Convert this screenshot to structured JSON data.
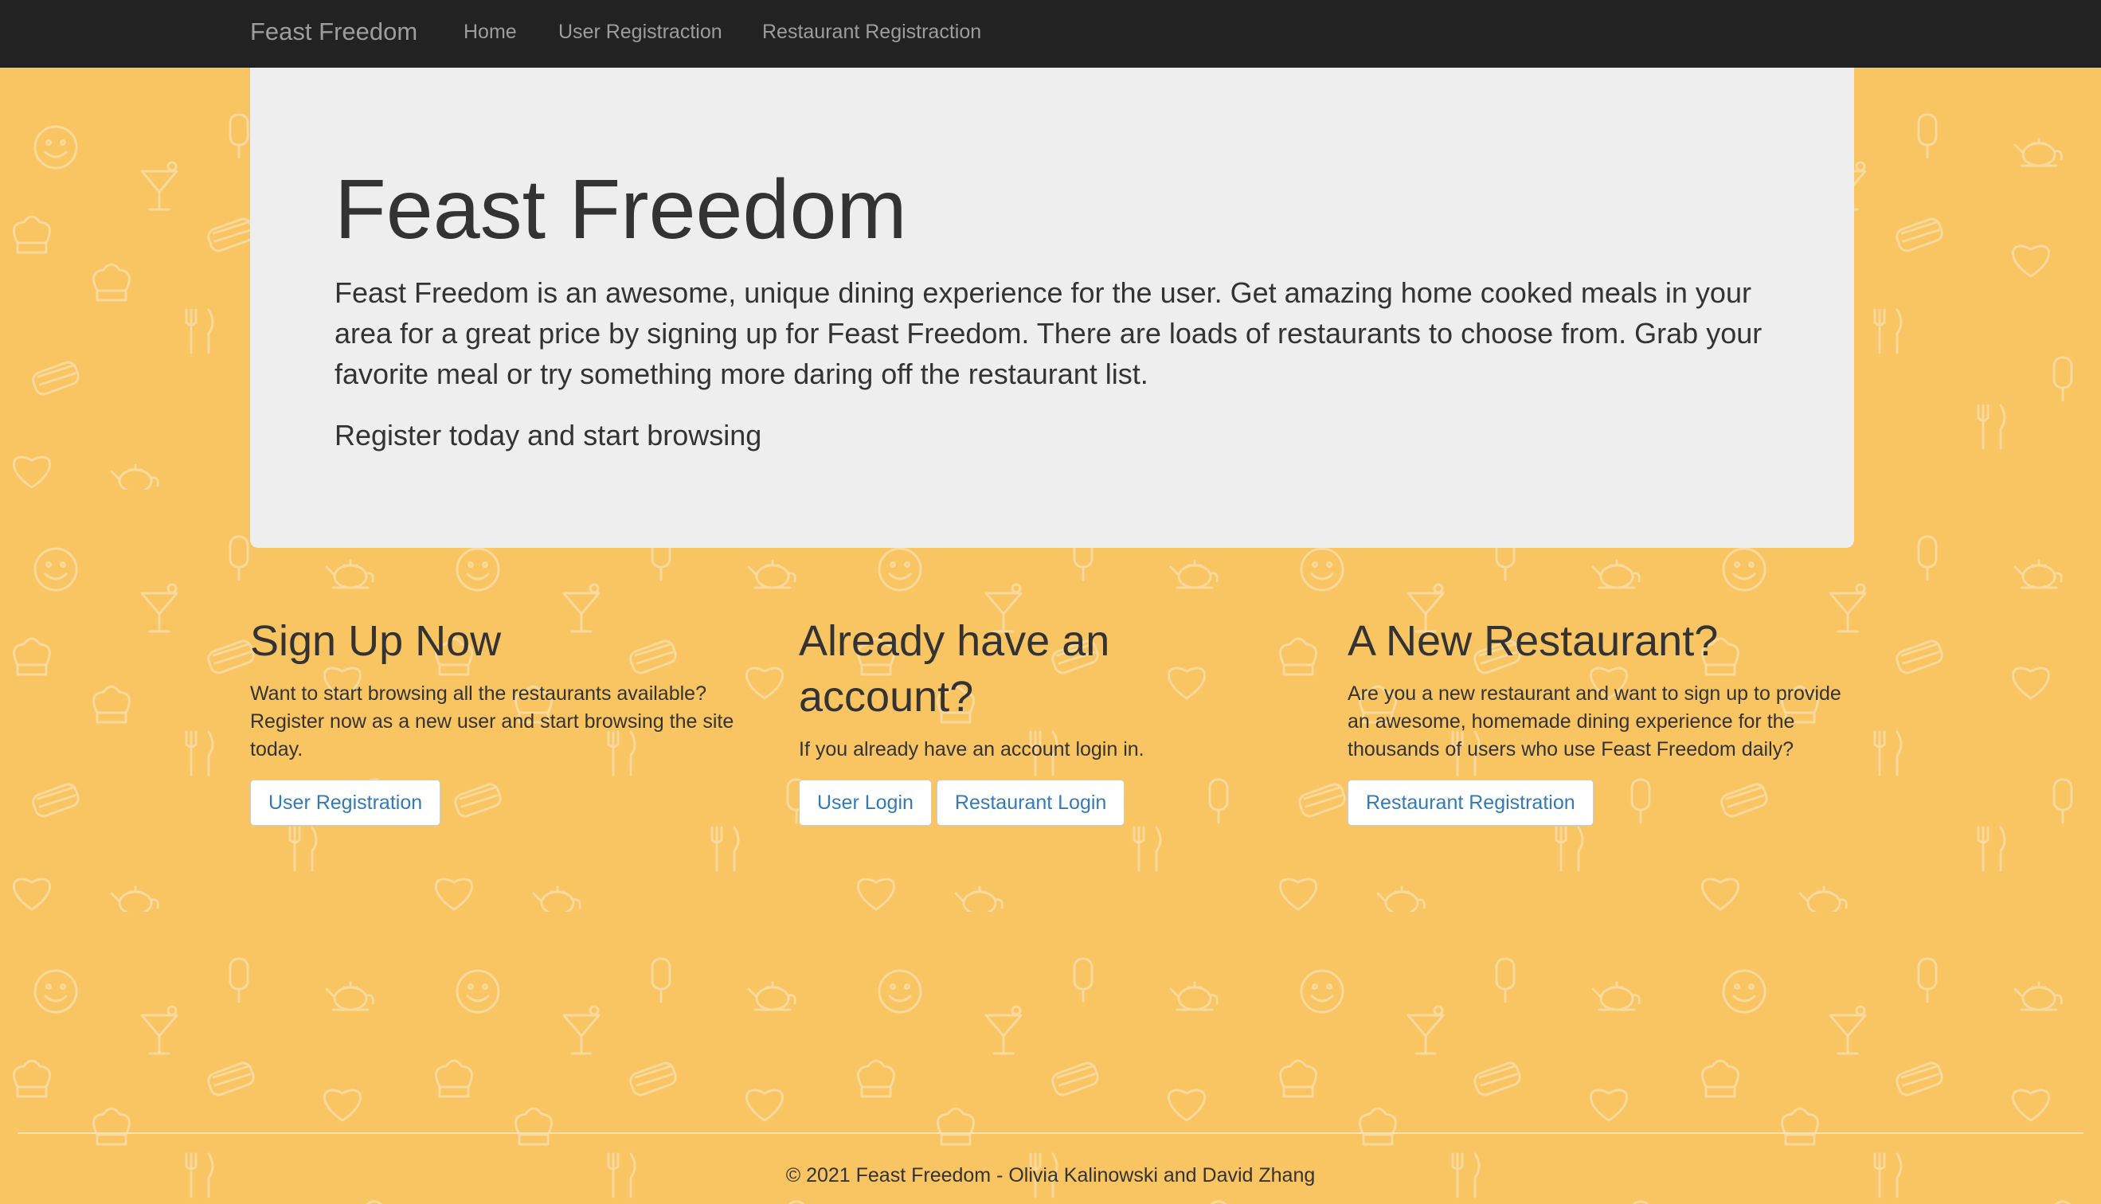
{
  "navbar": {
    "brand": "Feast Freedom",
    "links": [
      "Home",
      "User Registraction",
      "Restaurant Registraction"
    ]
  },
  "jumbotron": {
    "title": "Feast Freedom",
    "lead": "Feast Freedom is an awesome, unique dining experience for the user. Get amazing home cooked meals in your area for a great price by signing up for Feast Freedom. There are loads of restaurants to choose from. Grab your favorite meal or try something more daring off the restaurant list.",
    "cta": "Register today and start browsing"
  },
  "columns": [
    {
      "heading": "Sign Up Now",
      "text": "Want to start browsing all the restaurants available? Register now as a new user and start browsing the site today.",
      "buttons": [
        "User Registration"
      ]
    },
    {
      "heading": "Already have an account?",
      "text": "If you already have an account login in.",
      "buttons": [
        "User Login",
        "Restaurant Login"
      ]
    },
    {
      "heading": "A New Restaurant?",
      "text": "Are you a new restaurant and want to sign up to provide an awesome, homemade dining experience for the thousands of users who use Feast Freedom daily?",
      "buttons": [
        "Restaurant Registration"
      ]
    }
  ],
  "footer": {
    "text": "© 2021 Feast Freedom - Olivia Kalinowski and David Zhang"
  },
  "colors": {
    "background": "#f9c462",
    "navbar": "#222222",
    "jumbotron": "#eeeeee",
    "link": "#337ab7",
    "pattern_stroke": "#fbdca3"
  },
  "pattern_icons": [
    "smiley-icon",
    "cocktail-icon",
    "teapot-icon",
    "sandwich-icon",
    "chef-hat-icon",
    "fork-knife-icon",
    "popsicle-icon",
    "heart-icon"
  ]
}
